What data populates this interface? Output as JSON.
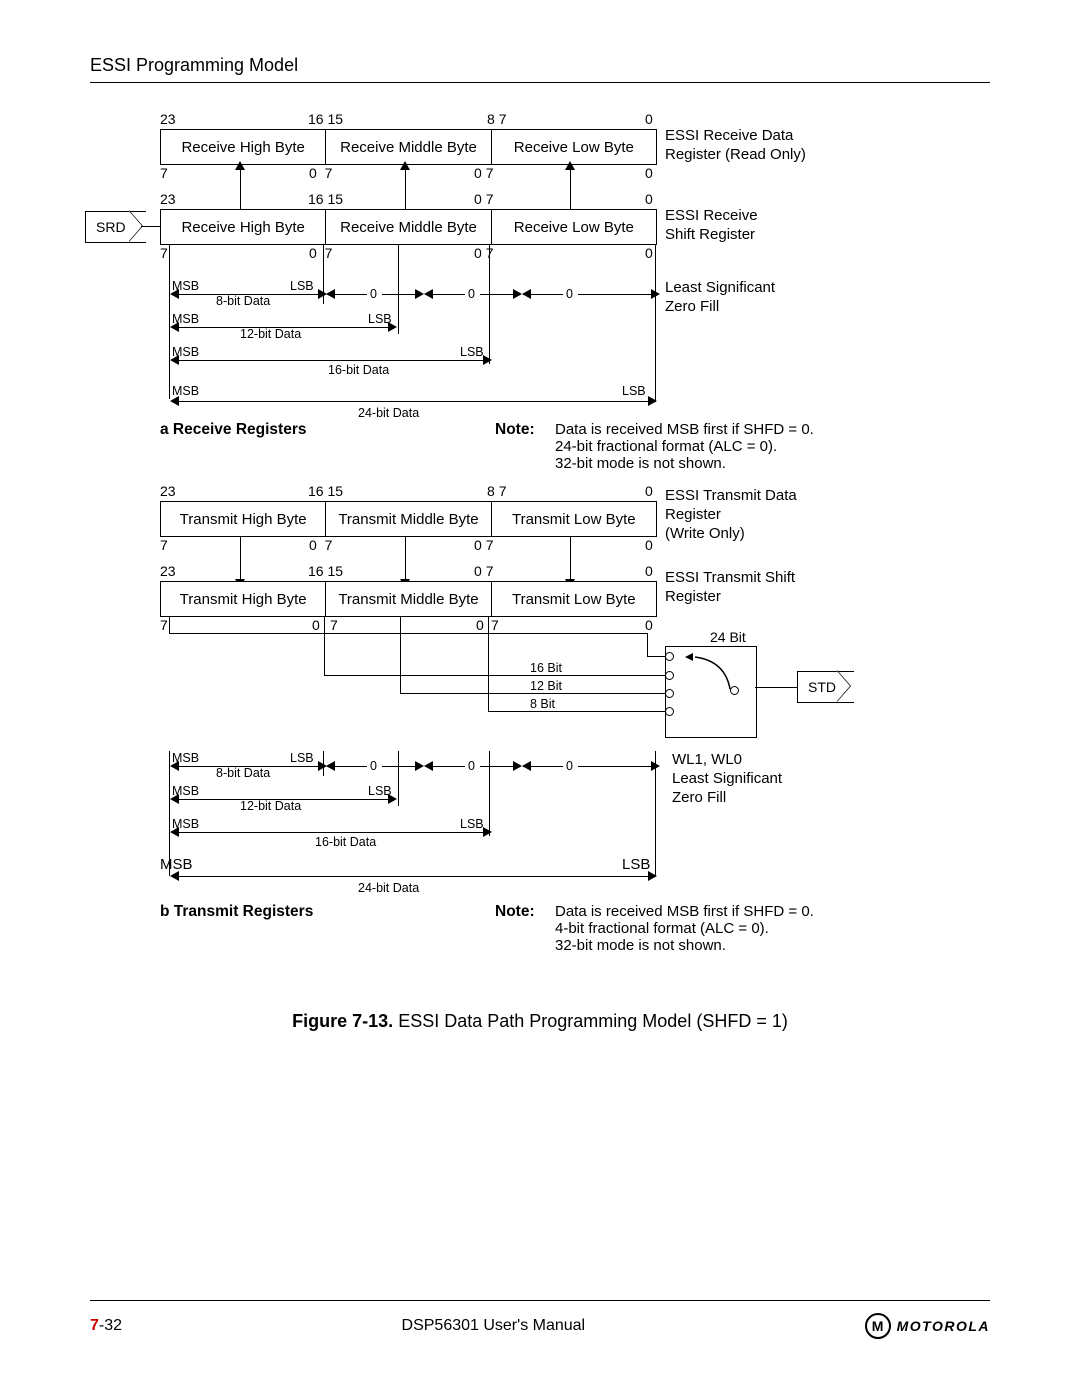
{
  "header": {
    "section_title": "ESSI Programming Model"
  },
  "ports": {
    "srd": "SRD",
    "std": "STD"
  },
  "bitnums": {
    "b23": "23",
    "b16": "16",
    "b15": "15",
    "b8": "8",
    "b7": "7",
    "b0": "0",
    "s7": "7",
    "s0": "0",
    "s07": "0 7"
  },
  "receive": {
    "data_reg": {
      "high": "Receive High Byte",
      "mid": "Receive Middle Byte",
      "low": "Receive Low Byte",
      "label1": "ESSI Receive Data",
      "label2": "Register (Read Only)"
    },
    "shift_reg": {
      "high": "Receive High Byte",
      "mid": "Receive Middle Byte",
      "low": "Receive Low Byte",
      "label1": "ESSI Receive",
      "label2": "Shift Register"
    },
    "zero_fill": {
      "l1": "Least Significant",
      "l2": "Zero Fill"
    },
    "bits": {
      "msb": "MSB",
      "lsb": "LSB",
      "d8": "8-bit Data",
      "d12": "12-bit Data",
      "d16": "16-bit Data",
      "d24": "24-bit Data",
      "z": "0"
    },
    "caption": "a Receive Registers",
    "note_label": "Note:",
    "note1": "Data is received MSB first if SHFD = 0.",
    "note2": "24-bit fractional format (ALC = 0).",
    "note3": "32-bit mode is not shown."
  },
  "transmit": {
    "data_reg": {
      "high": "Transmit High Byte",
      "mid": "Transmit Middle Byte",
      "low": "Transmit Low Byte",
      "label1": "ESSI Transmit Data",
      "label2": "Register",
      "label3": "(Write Only)"
    },
    "shift_reg": {
      "high": "Transmit High Byte",
      "mid": "Transmit Middle Byte",
      "low": "Transmit Low Byte",
      "label1": "ESSI Transmit Shift",
      "label2": "Register"
    },
    "bitout": {
      "b24": "24 Bit",
      "b16": "16 Bit",
      "b12": "12 Bit",
      "b8": "8 Bit"
    },
    "wl": {
      "l0": "WL1, WL0",
      "l1": "Least Significant",
      "l2": "Zero Fill"
    },
    "bits": {
      "msb": "MSB",
      "lsb": "LSB",
      "d8": "8-bit Data",
      "d12": "12-bit Data",
      "d16": "16-bit Data",
      "d24": "24-bit Data",
      "z": "0"
    },
    "caption": "b Transmit Registers",
    "note_label": "Note:",
    "note1": "Data is received MSB first if SHFD = 0.",
    "note2": "4-bit fractional format (ALC = 0).",
    "note3": "32-bit mode is not shown."
  },
  "figure": {
    "label": "Figure 7-13.",
    "caption": " ESSI Data Path Programming Model (SHFD = 1)"
  },
  "footer": {
    "page_prefix": "7",
    "page_dash": "-32",
    "manual": "DSP56301 User's Manual",
    "brand_letter": "M",
    "brand": "MOTOROLA"
  }
}
